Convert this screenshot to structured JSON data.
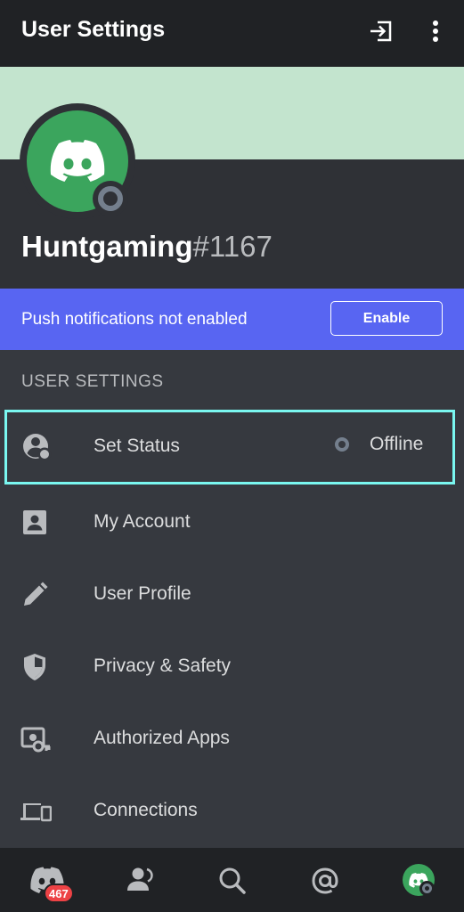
{
  "header": {
    "title": "User Settings",
    "logout_icon": "logout-icon",
    "more_icon": "more-vertical-icon"
  },
  "profile": {
    "banner_color": "#c3e4ce",
    "avatar_color": "#3ba55d",
    "avatar_icon": "discord-logo-icon",
    "status_color": "#747f8d",
    "username": "Huntgaming",
    "discriminator": "#1167"
  },
  "push_banner": {
    "message": "Push notifications not enabled",
    "button_label": "Enable",
    "color": "#5865f2"
  },
  "settings": {
    "section_title": "USER SETTINGS",
    "items": [
      {
        "label": "Set Status",
        "icon": "status-person-icon",
        "value": "Offline"
      },
      {
        "label": "My Account",
        "icon": "account-card-icon"
      },
      {
        "label": "User Profile",
        "icon": "pencil-icon"
      },
      {
        "label": "Privacy & Safety",
        "icon": "shield-icon"
      },
      {
        "label": "Authorized Apps",
        "icon": "key-app-icon"
      },
      {
        "label": "Connections",
        "icon": "devices-icon"
      }
    ]
  },
  "bottom_nav": {
    "items": [
      {
        "name": "home",
        "icon": "discord-home-icon",
        "badge": "467"
      },
      {
        "name": "friends",
        "icon": "friends-icon"
      },
      {
        "name": "search",
        "icon": "search-icon"
      },
      {
        "name": "mentions",
        "icon": "mention-icon"
      },
      {
        "name": "profile",
        "icon": "avatar-icon"
      }
    ]
  },
  "colors": {
    "highlight_border": "#7af7f0",
    "badge": "#ed4245"
  }
}
